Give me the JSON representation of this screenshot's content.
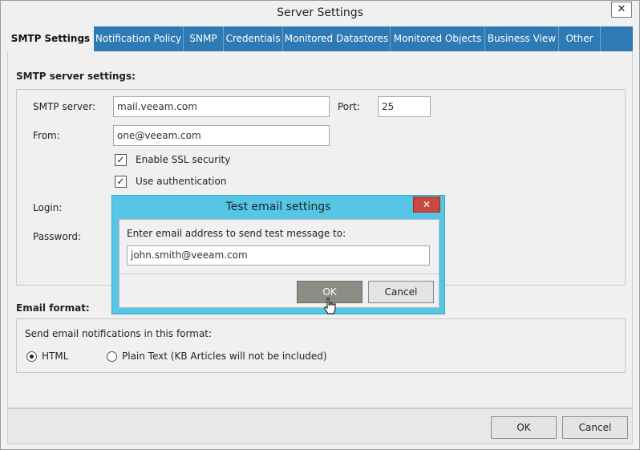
{
  "window": {
    "title": "Server Settings",
    "close_glyph": "✕"
  },
  "tabs": [
    {
      "label": "SMTP Settings",
      "active": true
    },
    {
      "label": "Notification Policy",
      "active": false
    },
    {
      "label": "SNMP",
      "active": false
    },
    {
      "label": "Credentials",
      "active": false
    },
    {
      "label": "Monitored Datastores",
      "active": false
    },
    {
      "label": "Monitored Objects",
      "active": false
    },
    {
      "label": "Business View",
      "active": false
    },
    {
      "label": "Other",
      "active": false
    }
  ],
  "smtp": {
    "section_title": "SMTP server settings:",
    "server_label": "SMTP server:",
    "server_value": "mail.veeam.com",
    "port_label": "Port:",
    "port_value": "25",
    "from_label": "From:",
    "from_value": "one@veeam.com",
    "ssl_label": "Enable SSL security",
    "ssl_checked": true,
    "auth_label": "Use authentication",
    "auth_checked": true,
    "login_label": "Login:",
    "password_label": "Password:"
  },
  "email_format": {
    "section_title": "Email format:",
    "prompt": "Send email notifications in this format:",
    "html_label": "HTML",
    "html_selected": true,
    "plain_label": "Plain Text (KB Articles will not be included)",
    "plain_selected": false
  },
  "footer": {
    "ok_label": "OK",
    "cancel_label": "Cancel"
  },
  "test_dialog": {
    "title": "Test email settings",
    "close_glyph": "✕",
    "prompt": "Enter email address to send test message to:",
    "email_value": "john.smith@veeam.com",
    "ok_label": "OK",
    "cancel_label": "Cancel"
  },
  "colors": {
    "accent_tab_bar": "#2e7ab5",
    "dialog_frame": "#56c6e6",
    "dialog_close": "#c9493f"
  }
}
